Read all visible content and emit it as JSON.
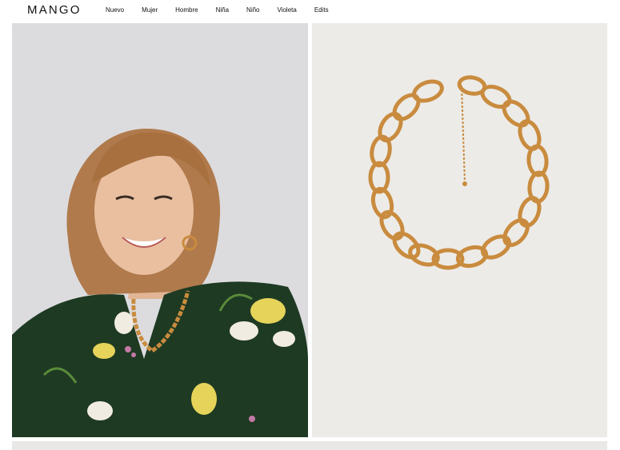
{
  "header": {
    "logo_text": "MANGO",
    "nav": [
      "Nuevo",
      "Mujer",
      "Hombre",
      "Niña",
      "Niño",
      "Violeta",
      "Edits"
    ]
  },
  "products": [
    {
      "image": "model-wearing-chain-necklace"
    },
    {
      "image": "gold-chain-necklace"
    }
  ],
  "colors": {
    "accent_gold": "#c98b3e",
    "blouse_green": "#1e3a22",
    "background_right": "#ecebe7",
    "background_left": "#dcdcdf"
  }
}
